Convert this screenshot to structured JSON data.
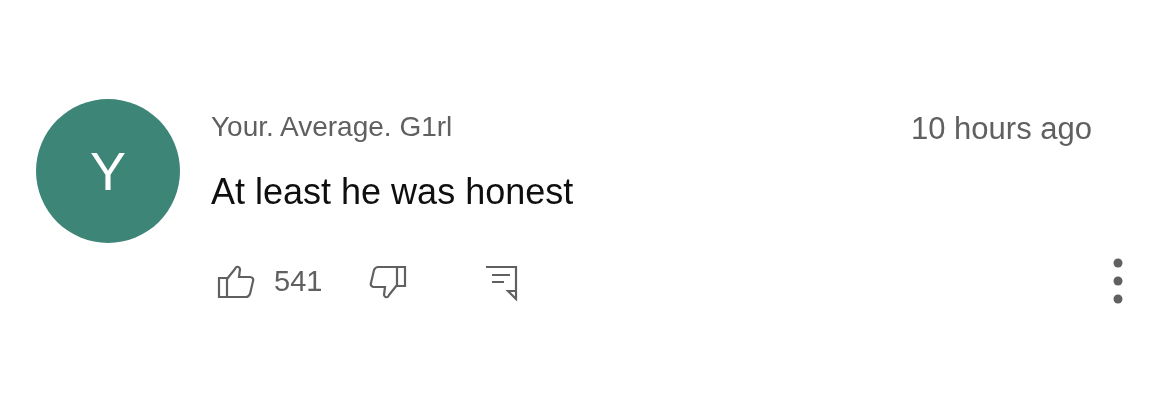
{
  "comment": {
    "avatar_letter": "Y",
    "author": "Your. Average. G1rl",
    "time": "10 hours ago",
    "text": "At least he was honest",
    "like_count": "541"
  }
}
